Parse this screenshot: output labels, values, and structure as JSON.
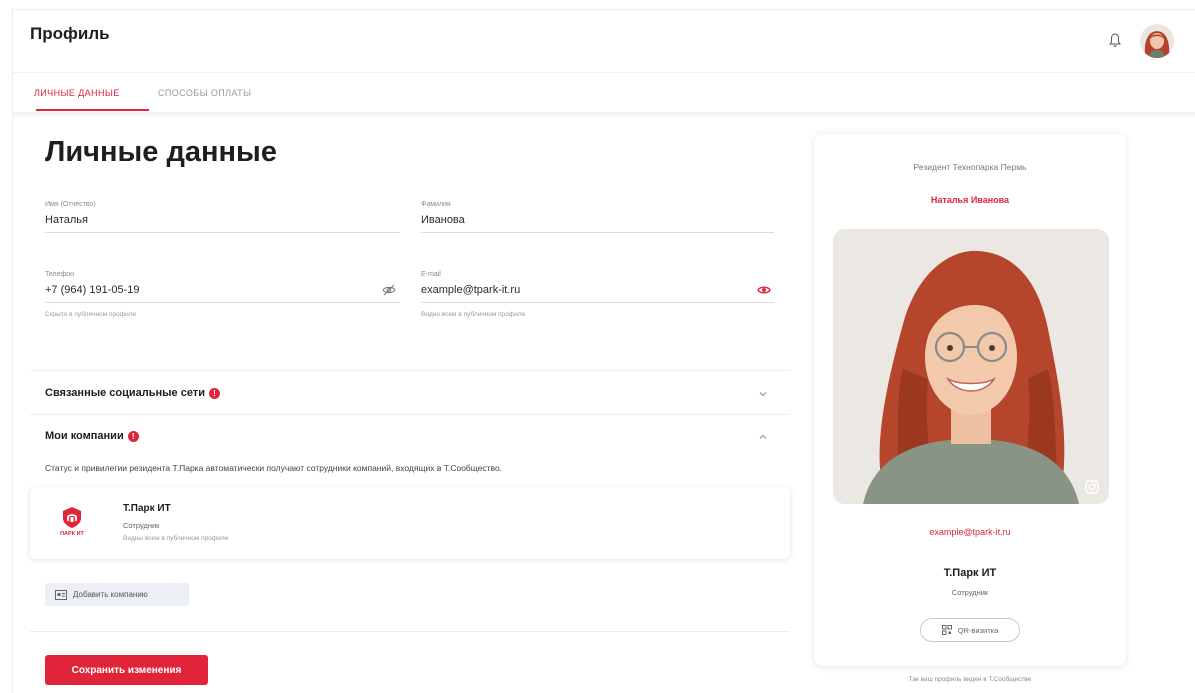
{
  "header": {
    "title": "Профиль",
    "icons": [
      "bell-icon",
      "avatar"
    ]
  },
  "tabs": [
    {
      "label": "личные данные",
      "active": true
    },
    {
      "label": "способы оплаты",
      "active": false
    }
  ],
  "main": {
    "heading": "Личные данные",
    "fields": {
      "first_name": {
        "label": "Имя (Отчество)",
        "value": "Наталья"
      },
      "last_name": {
        "label": "Фамилия",
        "value": "Иванова"
      },
      "phone": {
        "label": "Телефон",
        "value": "+7 (964) 191-05-19",
        "hint": "Скрыто в публичном профиле",
        "icon": "eye-off-icon"
      },
      "email": {
        "label": "E-mail",
        "value": "example@tpark-it.ru",
        "hint": "Видно всем в публичном профиле",
        "icon": "eye-icon"
      }
    },
    "socials": {
      "title": "Связанные социальные сети",
      "badge": "!"
    },
    "companies": {
      "title": "Мои компании",
      "badge": "!",
      "description": "Статус и привилегии резидента Т.Парка автоматически получают сотрудники компаний, входящих в Т.Сообщество.",
      "items": [
        {
          "logo_text": "ПАРК ИТ",
          "name": "Т.Парк ИТ",
          "role": "Сотрудник",
          "visibility": "Видны всем в публичном профиле"
        }
      ],
      "add_label": "Добавить компанию"
    },
    "save_label": "Сохранить изменения"
  },
  "profile_card": {
    "resident_text": "Резидент Технопарка Пермь",
    "name": "Наталья Иванова",
    "email": "example@tpark-it.ru",
    "company": "Т.Парк ИТ",
    "role": "Сотрудник",
    "qr_label": "QR-визитка",
    "footer": "Так ваш профиль виден в Т.Сообществе"
  },
  "colors": {
    "accent": "#e0243a",
    "text": "#1e1e1e",
    "muted": "#8a8a8a",
    "divider": "#ececec"
  }
}
